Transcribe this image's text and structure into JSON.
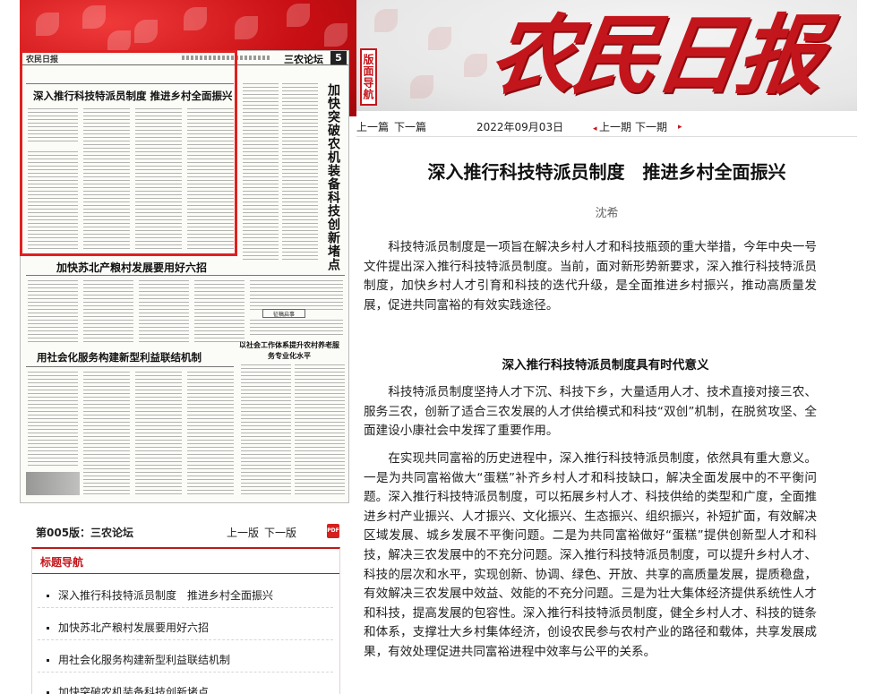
{
  "masthead": {
    "name": "农民日报",
    "nav_badge": "版面导航"
  },
  "thumbnail": {
    "logo": "农民日报",
    "section": "三农论坛",
    "page_number": "5",
    "headlines": {
      "top": "深入推行科技特派员制度  推进乡村全面振兴",
      "vertical": "加快突破农机装备科技创新堵点",
      "second": "加快苏北产粮村发展要用好六招",
      "third": "用社会化服务构建新型利益联结机制",
      "column_head": "以社会工作体系提升农村养老服务专业化水平",
      "small_box": "征稿启事"
    }
  },
  "page_nav": {
    "page_label": "第005版：三农论坛",
    "prev": "上一版",
    "next": "下一版",
    "pdf_icon": "pdf-icon"
  },
  "title_nav": {
    "heading": "标题导航",
    "items": [
      "深入推行科技特派员制度　推进乡村全面振兴",
      "加快苏北产粮村发展要用好六招",
      "用社会化服务构建新型利益联结机制",
      "加快突破农机装备科技创新堵点"
    ]
  },
  "article_nav": {
    "prev_article": "上一篇",
    "next_article": "下一篇",
    "date": "2022年09月03日",
    "prev_issue": "上一期",
    "next_issue": "下一期"
  },
  "article": {
    "title": "深入推行科技特派员制度　推进乡村全面振兴",
    "author": "沈希",
    "paragraphs": [
      "科技特派员制度是一项旨在解决乡村人才和科技瓶颈的重大举措，今年中央一号文件提出深入推行科技特派员制度。当前，面对新形势新要求，深入推行科技特派员制度，加快乡村人才引育和科技的迭代升级，是全面推进乡村振兴，推动高质量发展，促进共同富裕的有效实践途径。",
      "科技特派员制度坚持人才下沉、科技下乡，大量适用人才、技术直接对接三农、服务三农，创新了适合三农发展的人才供给模式和科技“双创”机制，在脱贫攻坚、全面建设小康社会中发挥了重要作用。",
      "在实现共同富裕的历史进程中，深入推行科技特派员制度，依然具有重大意义。一是为共同富裕做大“蛋糕”补齐乡村人才和科技缺口，解决全面发展中的不平衡问题。深入推行科技特派员制度，可以拓展乡村人才、科技供给的类型和广度，全面推进乡村产业振兴、人才振兴、文化振兴、生态振兴、组织振兴，补短扩面，有效解决区域发展、城乡发展不平衡问题。二是为共同富裕做好“蛋糕”提供创新型人才和科技，解决三农发展中的不充分问题。深入推行科技特派员制度，可以提升乡村人才、科技的层次和水平，实现创新、协调、绿色、开放、共享的高质量发展，提质稳盘，有效解决三农发展中效益、效能的不充分问题。三是为壮大集体经济提供系统性人才和科技，提高发展的包容性。深入推行科技特派员制度，健全乡村人才、科技的链条和体系，支撑壮大乡村集体经济，创设农民参与农村产业的路径和载体，共享发展成果，有效处理促进共同富裕进程中效率与公平的关系。"
    ],
    "subheading": "深入推行科技特派员制度具有时代意义"
  },
  "colors": {
    "brand_red": "#c3161c",
    "highlight_red": "#e02020"
  }
}
